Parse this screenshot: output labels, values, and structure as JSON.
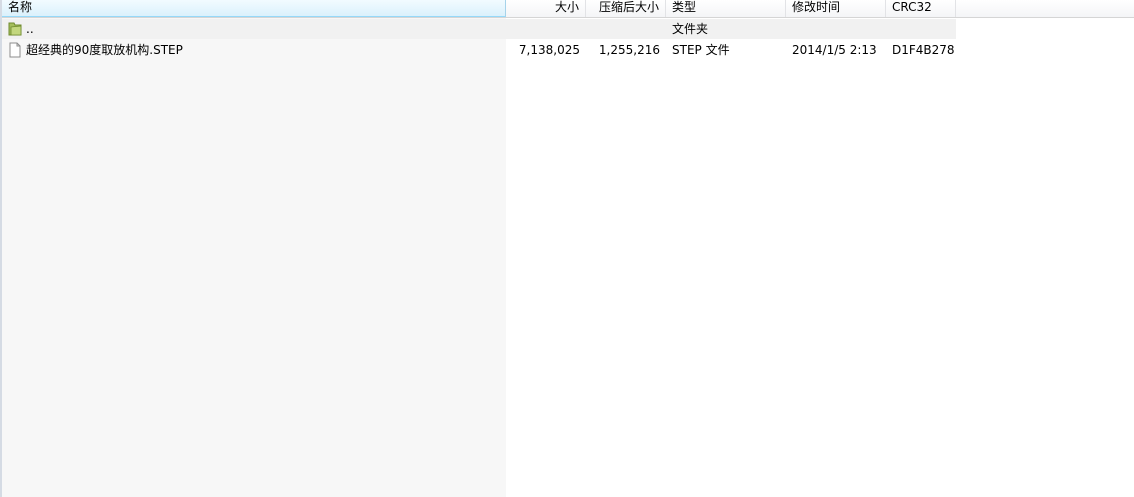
{
  "columns": {
    "name": "名称",
    "size": "大小",
    "packed": "压缩后大小",
    "type": "类型",
    "modified": "修改时间",
    "crc": "CRC32"
  },
  "parent_row": {
    "name": "..",
    "type": "文件夹",
    "icon": "folder-icon"
  },
  "file_row": {
    "name": "超经典的90度取放机构.STEP",
    "size": "7,138,025",
    "packed": "1,255,216",
    "type": "STEP 文件",
    "modified": "2014/1/5 2:13",
    "crc": "D1F4B278",
    "icon": "file-icon"
  },
  "colors": {
    "sorted_header": "#dbf1fc",
    "name_column_bg": "#f7f7f7",
    "folder": "#8fa84a"
  }
}
